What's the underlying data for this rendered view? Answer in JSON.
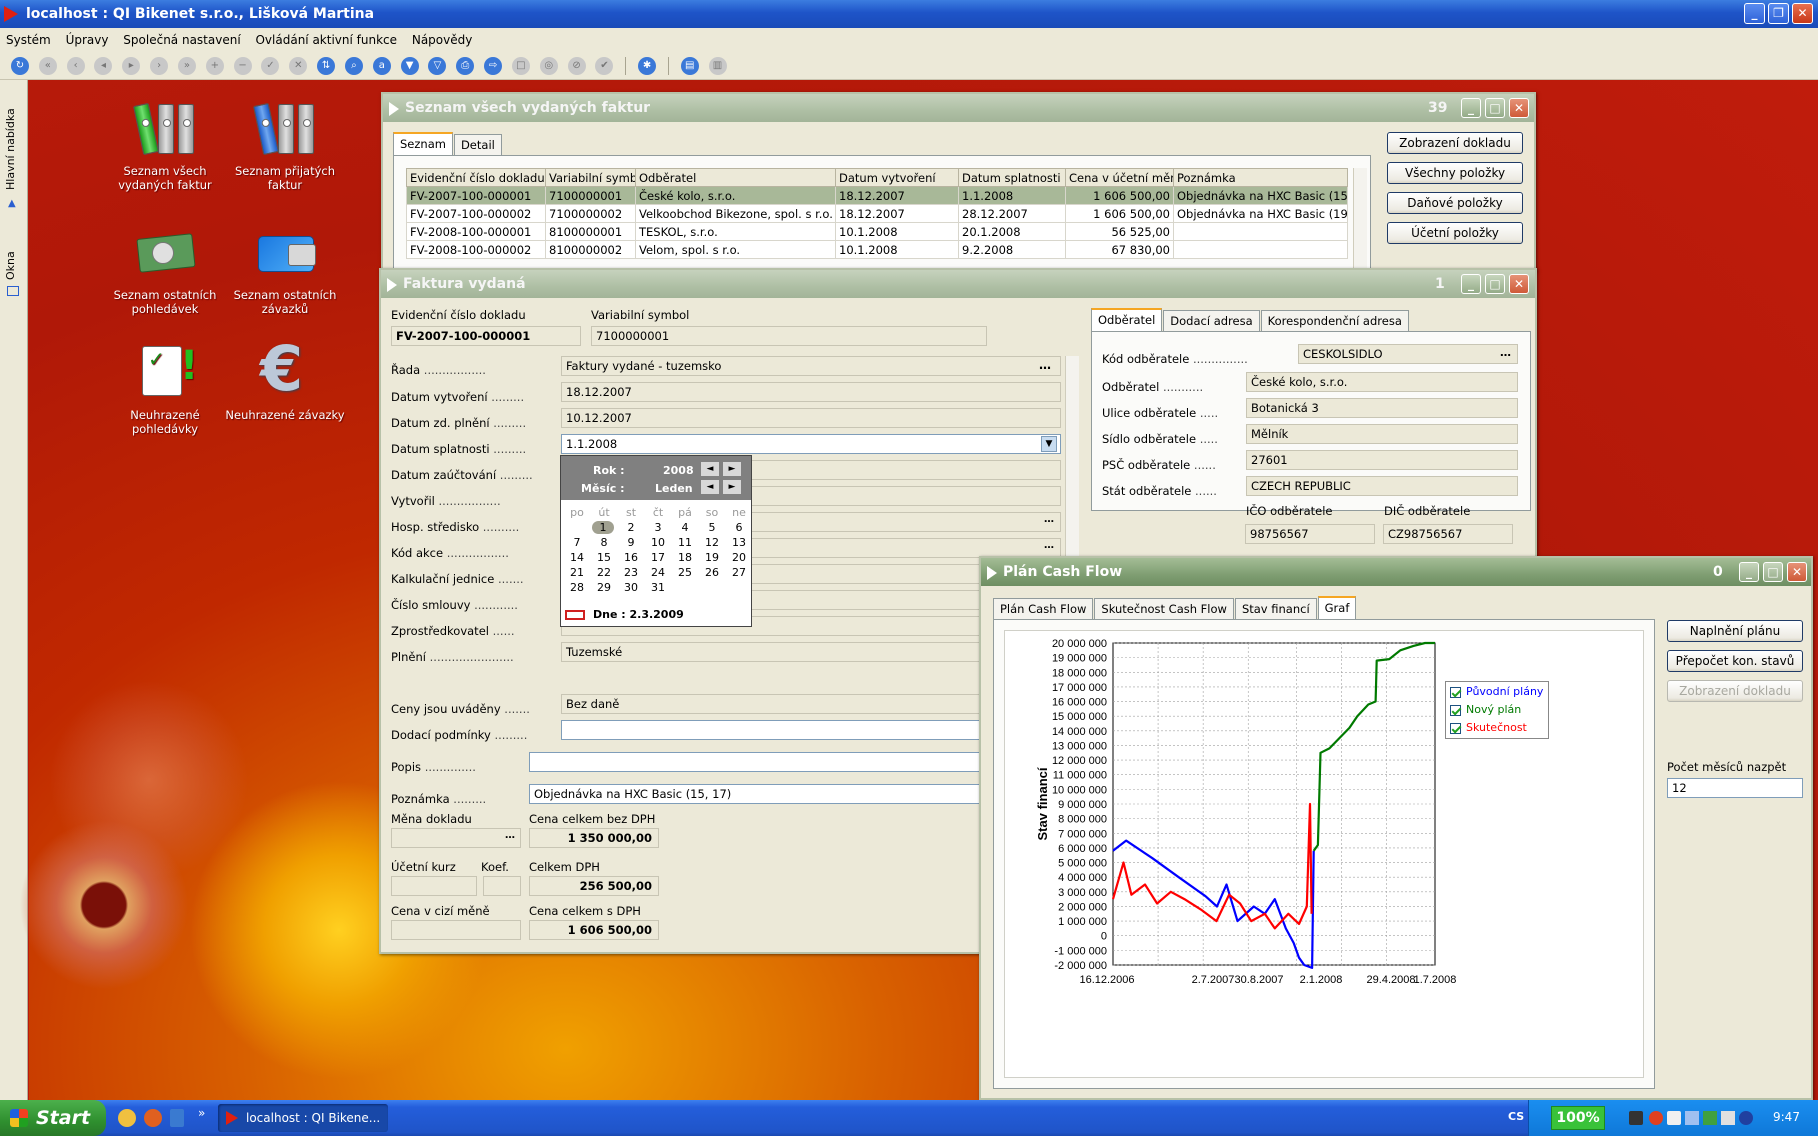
{
  "app": {
    "title": "localhost : QI  Bikenet s.r.o., Lišková Martina",
    "menu": [
      "Systém",
      "Úpravy",
      "Společná nastavení",
      "Ovládání aktivní funkce",
      "Nápovědy"
    ]
  },
  "left_bar": {
    "main_menu": "Hlavní nabídka",
    "windows": "Okna"
  },
  "desktop_icons": [
    {
      "label1": "Seznam všech",
      "label2": "vydaných faktur"
    },
    {
      "label1": "Seznam přijatých",
      "label2": "faktur"
    },
    {
      "label1": "Seznam ostatních",
      "label2": "pohledávek"
    },
    {
      "label1": "Seznam ostatních",
      "label2": "závazků"
    },
    {
      "label1": "Neuhrazené",
      "label2": "pohledávky"
    },
    {
      "label1": "Neuhrazené závazky",
      "label2": ""
    }
  ],
  "invoice_list": {
    "title": "Seznam všech vydaných faktur",
    "count": "39",
    "tabs": [
      "Seznam",
      "Detail"
    ],
    "columns": [
      "Evidenční číslo dokladu",
      "Variabilní symbol",
      "Odběratel",
      "Datum vytvoření",
      "Datum splatnosti",
      "Cena v účetní měně",
      "Poznámka"
    ],
    "rows": [
      [
        "FV-2007-100-000001",
        "7100000001",
        "České kolo, s.r.o.",
        "18.12.2007",
        "1.1.2008",
        "1 606 500,00",
        "Objednávka na HXC Basic (15,"
      ],
      [
        "FV-2007-100-000002",
        "7100000002",
        "Velkoobchod Bikezone, spol. s r.o.",
        "18.12.2007",
        "28.12.2007",
        "1 606 500,00",
        "Objednávka na HXC Basic (19, 2"
      ],
      [
        "FV-2008-100-000001",
        "8100000001",
        "TESKOL, s.r.o.",
        "10.1.2008",
        "20.1.2008",
        "56 525,00",
        ""
      ],
      [
        "FV-2008-100-000002",
        "8100000002",
        "Velom, spol. s r.o.",
        "10.1.2008",
        "9.2.2008",
        "67 830,00",
        ""
      ]
    ],
    "buttons": [
      "Zobrazení dokladu",
      "Všechny položky",
      "Daňové položky",
      "Účetní položky"
    ]
  },
  "invoice": {
    "title": "Faktura vydaná",
    "count": "1",
    "doc_number_label": "Evidenční číslo dokladu",
    "doc_number": "FV-2007-100-000001",
    "var_symbol_label": "Variabilní symbol",
    "var_symbol": "7100000001",
    "fields": [
      {
        "label": "Řada",
        "value": "Faktury vydané - tuzemsko"
      },
      {
        "label": "Datum vytvoření",
        "value": "18.12.2007"
      },
      {
        "label": "Datum zd. plnění",
        "value": "10.12.2007"
      },
      {
        "label": "Datum splatnosti",
        "value": "1.1.2008"
      },
      {
        "label": "Datum zaúčtování",
        "value": ""
      },
      {
        "label": "Vytvořil",
        "value": ""
      },
      {
        "label": "Hosp. středisko",
        "value": ""
      },
      {
        "label": "Kód akce",
        "value": ""
      },
      {
        "label": "Kalkulační jednice",
        "value": ""
      },
      {
        "label": "Číslo smlouvy",
        "value": ""
      },
      {
        "label": "Zprostředkovatel",
        "value": ""
      },
      {
        "label": "Plnění",
        "value": "Tuzemské"
      },
      {
        "label": "Ceny jsou uváděny",
        "value": "Bez daně"
      },
      {
        "label": "Dodací podmínky",
        "value": ""
      },
      {
        "label": "Popis",
        "value": ""
      },
      {
        "label": "Poznámka",
        "value": "Objednávka na HXC Basic (15, 17)"
      }
    ],
    "currency_label": "Měna dokladu",
    "total_no_vat_label": "Cena celkem bez DPH",
    "total_no_vat": "1 350 000,00",
    "rate_label": "Účetní kurz",
    "coef_label": "Koef.",
    "vat_label": "Celkem DPH",
    "vat": "256 500,00",
    "foreign_label": "Cena v cizí měně",
    "total_vat_label": "Cena celkem s DPH",
    "total_vat": "1 606 500,00",
    "customer_tabs": [
      "Odběratel",
      "Dodací adresa",
      "Korespondenční adresa"
    ],
    "customer": {
      "code_label": "Kód odběratele",
      "code": "CESKOLSIDLO",
      "name_label": "Odběratel",
      "name": "České kolo, s.r.o.",
      "street_label": "Ulice odběratele",
      "street": "Botanická 3",
      "city_label": "Sídlo odběratele",
      "city": "Mělník",
      "zip_label": "PSČ odběratele",
      "zip": "27601",
      "country_label": "Stát odběratele",
      "country": "CZECH REPUBLIC",
      "ico_label": "IČO odběratele",
      "ico": "98756567",
      "dic_label": "DIČ odběratele",
      "dic": "CZ98756567"
    }
  },
  "calendar": {
    "year_label": "Rok :",
    "year": "2008",
    "month_label": "Měsíc :",
    "month": "Leden",
    "weekdays": [
      "po",
      "út",
      "st",
      "čt",
      "pá",
      "so",
      "ne"
    ],
    "weeks": [
      [
        "",
        "1",
        "2",
        "3",
        "4",
        "5",
        "6"
      ],
      [
        "7",
        "8",
        "9",
        "10",
        "11",
        "12",
        "13"
      ],
      [
        "14",
        "15",
        "16",
        "17",
        "18",
        "19",
        "20"
      ],
      [
        "21",
        "22",
        "23",
        "24",
        "25",
        "26",
        "27"
      ],
      [
        "28",
        "29",
        "30",
        "31",
        "",
        "",
        ""
      ]
    ],
    "today_label": "Dne : 2.3.2009"
  },
  "cashflow": {
    "title": "Plán Cash Flow",
    "count": "0",
    "tabs": [
      "Plán Cash Flow",
      "Skutečnost Cash Flow",
      "Stav financí",
      "Graf"
    ],
    "buttons": [
      "Naplnění plánu",
      "Přepočet kon. stavů",
      "Zobrazení dokladu"
    ],
    "months_back_label": "Počet měsíců nazpět",
    "months_back": "12",
    "colors": {
      "plan": "#0000ff",
      "new": "#007a00",
      "actual": "#ff0000"
    }
  },
  "chart_data": {
    "type": "line",
    "title": "",
    "xlabel": "",
    "ylabel": "Stav financí",
    "ylim": [
      -2000000,
      20000000
    ],
    "yticks": [
      "20 000 000",
      "19 000 000",
      "18 000 000",
      "17 000 000",
      "16 000 000",
      "15 000 000",
      "14 000 000",
      "13 000 000",
      "12 000 000",
      "11 000 000",
      "10 000 000",
      "9 000 000",
      "8 000 000",
      "7 000 000",
      "6 000 000",
      "5 000 000",
      "4 000 000",
      "3 000 000",
      "2 000 000",
      "1 000 000",
      "0",
      "-1 000 000",
      "-2 000 000"
    ],
    "xticks": [
      "16.12.2006",
      "2.7.2007",
      "30.8.2007",
      "2.1.2008",
      "29.4.2008",
      "1.7.2008"
    ],
    "xdomain": [
      "2006-12-16",
      "2008-08-20"
    ],
    "legend": "top-right",
    "grid": true,
    "series": [
      {
        "name": "Původní plány",
        "color": "#0000ff",
        "points": [
          [
            "2006-12-16",
            5800000
          ],
          [
            "2007-01-10",
            6500000
          ],
          [
            "2007-03-01",
            5300000
          ],
          [
            "2007-04-20",
            4000000
          ],
          [
            "2007-06-10",
            2700000
          ],
          [
            "2007-07-02",
            2000000
          ],
          [
            "2007-07-20",
            3500000
          ],
          [
            "2007-08-10",
            1000000
          ],
          [
            "2007-09-10",
            2000000
          ],
          [
            "2007-10-01",
            1500000
          ],
          [
            "2007-10-20",
            2500000
          ],
          [
            "2007-11-10",
            500000
          ],
          [
            "2007-11-25",
            -500000
          ],
          [
            "2007-12-05",
            -1500000
          ],
          [
            "2007-12-15",
            -2000000
          ],
          [
            "2007-12-30",
            -2200000
          ],
          [
            "2008-01-02",
            5800000
          ]
        ]
      },
      {
        "name": "Nový plán",
        "color": "#007a00",
        "points": [
          [
            "2008-01-02",
            5800000
          ],
          [
            "2008-01-10",
            6200000
          ],
          [
            "2008-01-15",
            12500000
          ],
          [
            "2008-02-01",
            12800000
          ],
          [
            "2008-02-20",
            13500000
          ],
          [
            "2008-03-10",
            14200000
          ],
          [
            "2008-03-25",
            15000000
          ],
          [
            "2008-04-15",
            15800000
          ],
          [
            "2008-04-29",
            16000000
          ],
          [
            "2008-05-01",
            18800000
          ],
          [
            "2008-05-25",
            18900000
          ],
          [
            "2008-06-15",
            19500000
          ],
          [
            "2008-07-10",
            19800000
          ],
          [
            "2008-08-01",
            20000000
          ],
          [
            "2008-08-20",
            20000000
          ]
        ]
      },
      {
        "name": "Skutečnost",
        "color": "#ff0000",
        "points": [
          [
            "2006-12-16",
            2500000
          ],
          [
            "2007-01-05",
            5000000
          ],
          [
            "2007-01-20",
            2800000
          ],
          [
            "2007-02-15",
            3500000
          ],
          [
            "2007-03-10",
            2200000
          ],
          [
            "2007-04-05",
            3000000
          ],
          [
            "2007-05-01",
            2500000
          ],
          [
            "2007-06-01",
            1800000
          ],
          [
            "2007-07-01",
            1000000
          ],
          [
            "2007-07-25",
            2800000
          ],
          [
            "2007-08-15",
            2200000
          ],
          [
            "2007-09-05",
            1000000
          ],
          [
            "2007-10-01",
            1500000
          ],
          [
            "2007-10-20",
            500000
          ],
          [
            "2007-11-15",
            1500000
          ],
          [
            "2007-12-05",
            800000
          ],
          [
            "2007-12-20",
            2000000
          ],
          [
            "2007-12-26",
            9000000
          ],
          [
            "2007-12-29",
            1500000
          ]
        ]
      }
    ]
  },
  "taskbar": {
    "start_label": "Start",
    "task_label": "localhost : QI  Bikene...",
    "zoom": "100%",
    "clock": "9:47"
  }
}
